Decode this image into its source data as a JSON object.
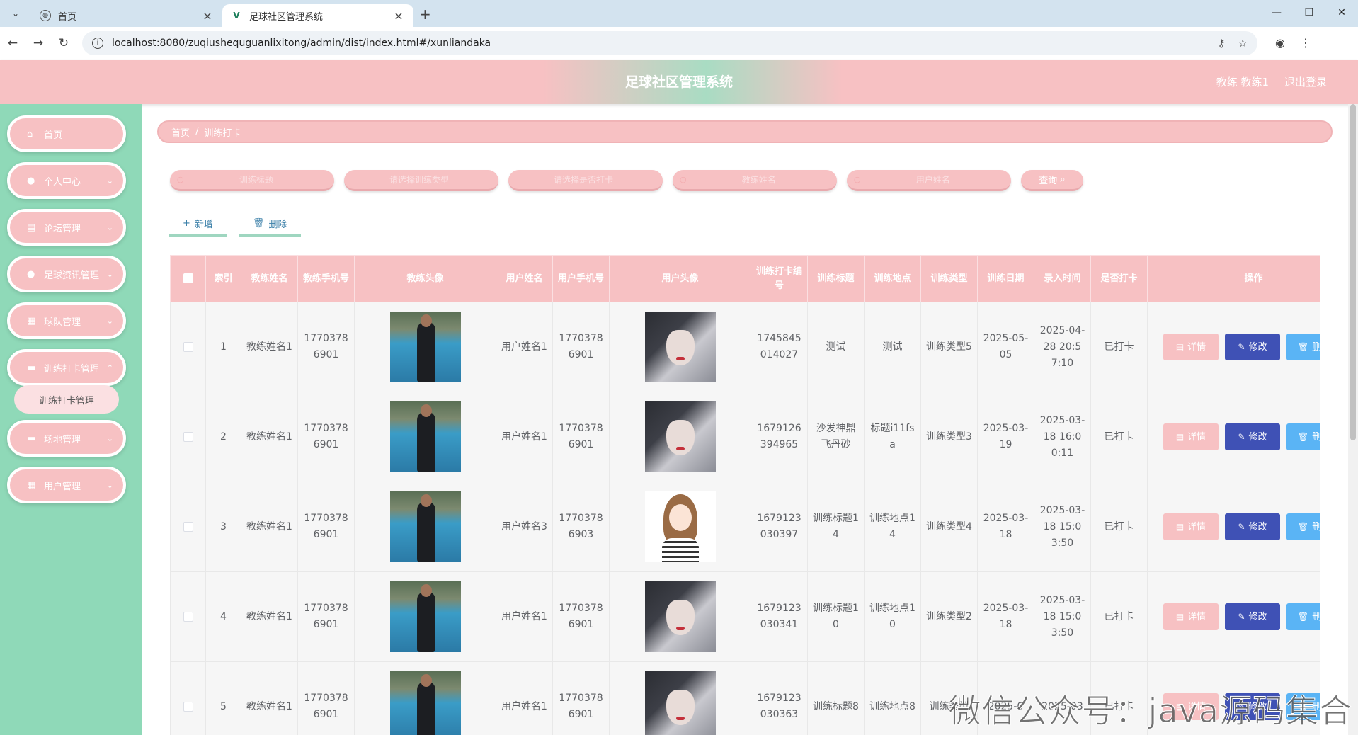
{
  "browser": {
    "tabs": [
      {
        "title": "首页",
        "active": false,
        "favicon": "globe-icon"
      },
      {
        "title": "足球社区管理系统",
        "active": true,
        "favicon": "vue-icon"
      }
    ],
    "url": "localhost:8080/zuqiushequguanlixitong/admin/dist/index.html#/xunliandaka"
  },
  "header": {
    "title": "足球社区管理系统",
    "user": "教练 教练1",
    "logout": "退出登录"
  },
  "sidebar": {
    "items": [
      {
        "label": "首页",
        "icon": "home-icon"
      },
      {
        "label": "个人中心",
        "icon": "user-icon"
      },
      {
        "label": "论坛管理",
        "icon": "forum-icon"
      },
      {
        "label": "足球资讯管理",
        "icon": "location-icon"
      },
      {
        "label": "球队管理",
        "icon": "grid-icon"
      },
      {
        "label": "训练打卡管理",
        "icon": "briefcase-icon"
      },
      {
        "label": "场地管理",
        "icon": "briefcase-icon"
      },
      {
        "label": "用户管理",
        "icon": "grid-icon"
      }
    ],
    "submenu": {
      "label": "训练打卡管理"
    }
  },
  "breadcrumb": {
    "home": "首页",
    "current": "训练打卡"
  },
  "search": {
    "fields": [
      {
        "placeholder": "训练标题"
      },
      {
        "placeholder": "请选择训练类型"
      },
      {
        "placeholder": "请选择是否打卡"
      },
      {
        "placeholder": "教练姓名"
      },
      {
        "placeholder": "用户姓名"
      }
    ],
    "button": "查询"
  },
  "actions": {
    "add": "新增",
    "delete": "删除"
  },
  "table": {
    "headers": [
      "索引",
      "教练姓名",
      "教练手机号",
      "教练头像",
      "用户姓名",
      "用户手机号",
      "用户头像",
      "训练打卡编号",
      "训练标题",
      "训练地点",
      "训练类型",
      "训练日期",
      "录入时间",
      "是否打卡",
      "操作"
    ],
    "rows": [
      {
        "index": "1",
        "coach_name": "教练姓名1",
        "coach_phone": "17703786901",
        "user_name": "用户姓名1",
        "user_phone": "17703786901",
        "user_avatar": "girl",
        "code": "1745845014027",
        "title": "测试",
        "place": "测试",
        "type": "训练类型5",
        "date": "2025-05-05",
        "created": "2025-04-28 20:57:10",
        "status": "已打卡"
      },
      {
        "index": "2",
        "coach_name": "教练姓名1",
        "coach_phone": "17703786901",
        "user_name": "用户姓名1",
        "user_phone": "17703786901",
        "user_avatar": "girl",
        "code": "1679126394965",
        "title": "沙发神鼎飞丹砂",
        "place": "标题i11fsa",
        "type": "训练类型3",
        "date": "2025-03-19",
        "created": "2025-03-18 16:00:11",
        "status": "已打卡"
      },
      {
        "index": "3",
        "coach_name": "教练姓名1",
        "coach_phone": "17703786901",
        "user_name": "用户姓名3",
        "user_phone": "17703786903",
        "user_avatar": "cartoon",
        "code": "1679123030397",
        "title": "训练标题14",
        "place": "训练地点14",
        "type": "训练类型4",
        "date": "2025-03-18",
        "created": "2025-03-18 15:03:50",
        "status": "已打卡"
      },
      {
        "index": "4",
        "coach_name": "教练姓名1",
        "coach_phone": "17703786901",
        "user_name": "用户姓名1",
        "user_phone": "17703786901",
        "user_avatar": "girl",
        "code": "1679123030341",
        "title": "训练标题10",
        "place": "训练地点10",
        "type": "训练类型2",
        "date": "2025-03-18",
        "created": "2025-03-18 15:03:50",
        "status": "已打卡"
      },
      {
        "index": "5",
        "coach_name": "教练姓名1",
        "coach_phone": "17703786901",
        "user_name": "用户姓名1",
        "user_phone": "17703786901",
        "user_avatar": "girl",
        "code": "1679123030363",
        "title": "训练标题8",
        "place": "训练地点8",
        "type": "训练类型",
        "date": "2025-0",
        "created": "2025-03",
        "status": "已打卡"
      }
    ],
    "row_actions": {
      "detail": "详情",
      "edit": "修改",
      "delete": "删除"
    }
  },
  "watermark": "微信公众号：java源码集合",
  "colors": {
    "pink": "#f7c1c3",
    "green": "#8fd9b8",
    "indigo": "#3f51b5",
    "sky": "#5ab4f5"
  }
}
